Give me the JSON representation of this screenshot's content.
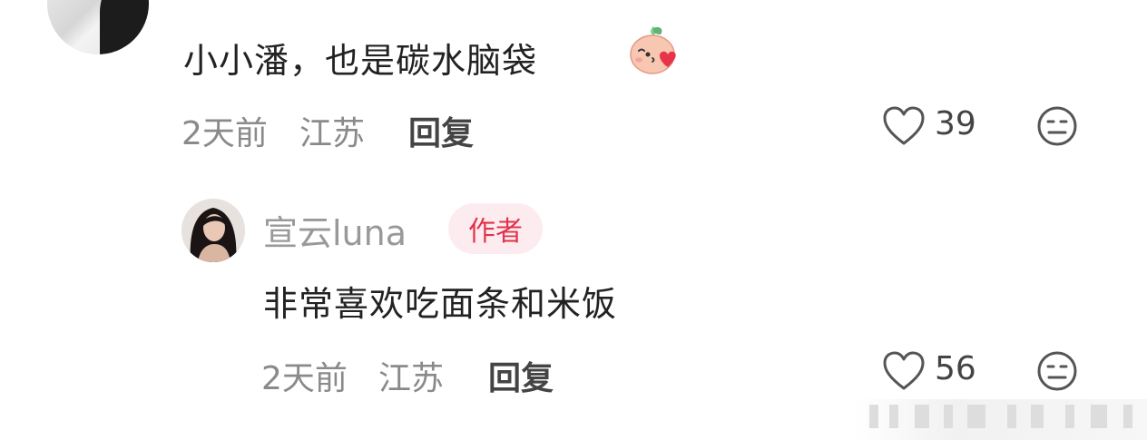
{
  "comment": {
    "text": "小小潘，也是碳水脑袋",
    "time": "2天前",
    "location": "江苏",
    "reply_label": "回复",
    "like_count": "39"
  },
  "sub_comment": {
    "username": "宣云luna",
    "badge": "作者",
    "text": "非常喜欢吃面条和米饭",
    "time": "2天前",
    "location": "江苏",
    "reply_label": "回复",
    "like_count": "56"
  },
  "colors": {
    "badge_bg": "#fdecef",
    "badge_text": "#e0344c",
    "meta_text": "#8a8a8a",
    "icon_stroke": "#555555"
  },
  "icons": {
    "emoji": "kiss-heart-emoji-icon",
    "like": "heart-outline-icon",
    "dislike": "meh-face-icon"
  }
}
